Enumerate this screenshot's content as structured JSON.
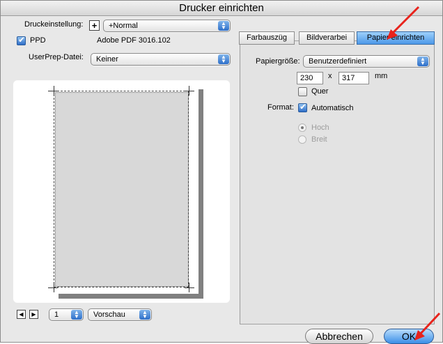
{
  "window": {
    "title": "Drucker einrichten"
  },
  "left": {
    "preset_label": "Druckeinstellung:",
    "preset_value": "+Normal",
    "ppd_label": "PPD",
    "ppd_value": "Adobe PDF 3016.102",
    "ppd_checked": true,
    "userprep_label": "UserPrep-Datei:",
    "userprep_value": "Keiner",
    "page_select_value": "1",
    "preview_mode_value": "Vorschau"
  },
  "tabs": [
    {
      "label": "Farbauszüg",
      "active": false
    },
    {
      "label": "Bildverarbei",
      "active": false
    },
    {
      "label": "Papier einrichten",
      "active": true
    }
  ],
  "paper": {
    "size_label": "Papiergröße:",
    "size_value": "Benutzerdefiniert",
    "width_value": "230",
    "times_symbol": "x",
    "height_value": "317",
    "unit": "mm",
    "quer_label": "Quer",
    "quer_checked": false,
    "format_label": "Format:",
    "auto_label": "Automatisch",
    "auto_checked": true,
    "hoch_label": "Hoch",
    "breit_label": "Breit"
  },
  "buttons": {
    "cancel": "Abbrechen",
    "ok": "OK"
  },
  "colors": {
    "accent": "#3b8ee8",
    "annotation_arrow": "#e8231c"
  }
}
